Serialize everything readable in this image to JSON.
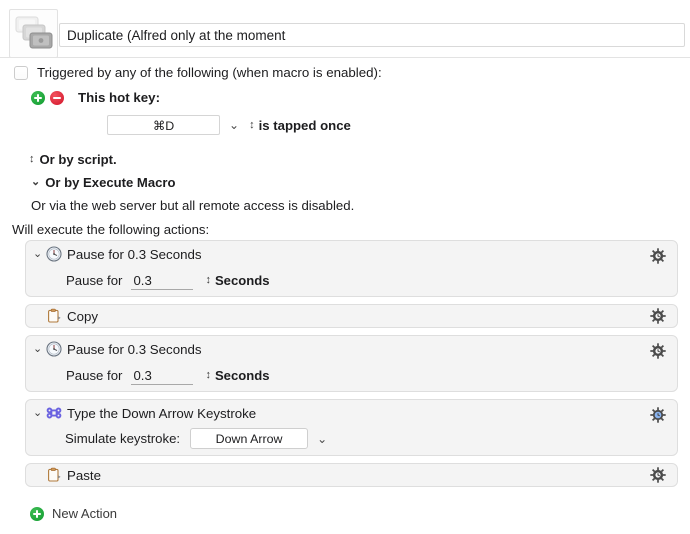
{
  "header": {
    "icon_name": "duplicate-macro-icon",
    "title_value": "Duplicate (Alfred only at the moment",
    "title_placeholder": "Macro Name"
  },
  "trigger": {
    "enabled_checkbox_label": "Triggered by any of the following (when macro is enabled):",
    "checked": false,
    "hot_key_label": "This hot key:",
    "add_icon": "plus-circle-icon",
    "remove_icon": "minus-circle-icon",
    "hotkey_value": "⌘D",
    "hotkey_dropdown_icon": "chevron-down-icon",
    "tap_mode_label": "is tapped once",
    "tap_mode_icon": "stepper-updown-icon",
    "or_by_script": "Or by script.",
    "or_by_script_icon": "stepper-updown-icon",
    "or_by_execute_macro": "Or by Execute Macro",
    "or_by_execute_macro_icon": "chevron-down-icon",
    "web_server_note": "Or via the web server but all remote access is disabled."
  },
  "actions_header": "Will execute the following actions:",
  "actions": [
    {
      "title": "Pause for 0.3 Seconds",
      "icon": "clock-icon",
      "expanded": true,
      "disclosure_icon": "chevron-down-icon",
      "gear_icon": "gear-icon",
      "gear_highlighted": false,
      "body_label": "Pause for",
      "value": "0.3",
      "unit": "Seconds",
      "unit_icon": "stepper-updown-icon"
    },
    {
      "title": "Copy",
      "icon": "clipboard-copy-icon",
      "expanded": false,
      "gear_icon": "gear-icon",
      "gear_highlighted": false
    },
    {
      "title": "Pause for 0.3 Seconds",
      "icon": "clock-icon",
      "expanded": true,
      "disclosure_icon": "chevron-down-icon",
      "gear_icon": "gear-icon",
      "gear_highlighted": false,
      "body_label": "Pause for",
      "value": "0.3",
      "unit": "Seconds",
      "unit_icon": "stepper-updown-icon"
    },
    {
      "title": "Type the Down Arrow Keystroke",
      "icon": "command-key-icon",
      "expanded": true,
      "disclosure_icon": "chevron-down-icon",
      "gear_icon": "gear-icon",
      "gear_highlighted": true,
      "body_label": "Simulate keystroke:",
      "keystroke_value": "Down Arrow",
      "keystroke_dropdown_icon": "chevron-down-icon"
    },
    {
      "title": "Paste",
      "icon": "clipboard-paste-icon",
      "expanded": false,
      "gear_icon": "gear-icon",
      "gear_highlighted": false
    }
  ],
  "new_action": {
    "label": "New Action",
    "icon": "plus-circle-icon"
  },
  "colors": {
    "panel_bg": "#f4f4f4",
    "panel_border": "#dedede",
    "add_green": "#0f9b2e",
    "remove_red": "#d2142a",
    "command_purple": "#6a62e0",
    "gear_highlight_blue": "#8ab4f0",
    "clipboard_brown": "#b07a3c"
  }
}
